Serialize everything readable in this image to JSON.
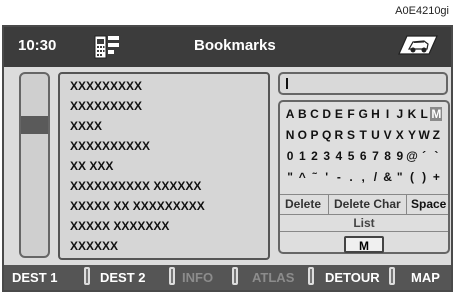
{
  "ref_code": "A0E4210gi",
  "header": {
    "time": "10:30",
    "title": "Bookmarks"
  },
  "list": {
    "items": [
      "XXXXXXXXX",
      "XXXXXXXXX",
      "XXXX",
      "XXXXXXXXXX",
      "XX XXX",
      "XXXXXXXXXX XXXXXX",
      "XXXXX XX XXXXXXXXX",
      "XXXXX XXXXXXX",
      "XXXXXX"
    ]
  },
  "input": {
    "value": ""
  },
  "keyboard": {
    "rows": [
      [
        "A",
        "B",
        "C",
        "D",
        "E",
        "F",
        "G",
        "H",
        "I",
        "J",
        "K",
        "L",
        "M"
      ],
      [
        "N",
        "O",
        "P",
        "Q",
        "R",
        "S",
        "T",
        "U",
        "V",
        "X",
        "Y",
        "W",
        "Z"
      ],
      [
        "0",
        "1",
        "2",
        "3",
        "4",
        "5",
        "6",
        "7",
        "8",
        "9",
        "@",
        "´",
        "`"
      ],
      [
        "\"",
        "^",
        "˜",
        "'",
        "-",
        ".",
        ",",
        "/",
        "&",
        "\"",
        "(",
        ")",
        "+"
      ]
    ],
    "selected": "M",
    "delete": "Delete",
    "delete_char": "Delete Char",
    "space": "Space",
    "list": "List",
    "m_button": "M"
  },
  "bottom_bar": {
    "dest1": "DEST 1",
    "dest2": "DEST 2",
    "info": "INFO",
    "atlas": "ATLAS",
    "detour": "DETOUR",
    "map": "MAP"
  }
}
